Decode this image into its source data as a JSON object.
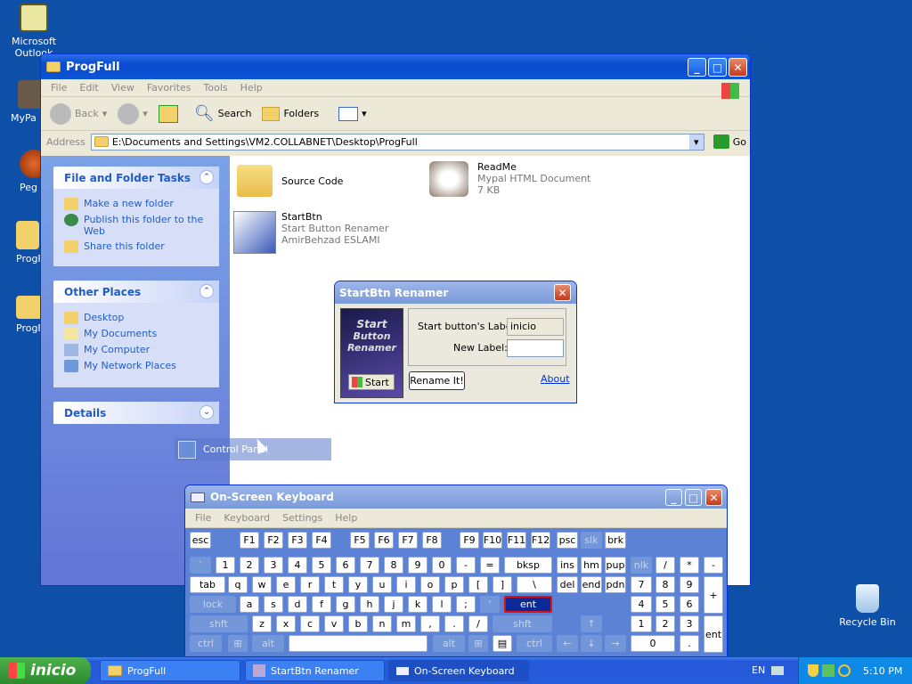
{
  "desktop": {
    "icons": [
      {
        "label": "Microsoft Outlook"
      },
      {
        "label": "MyPa"
      },
      {
        "label": "Peg"
      },
      {
        "label": "ProgF"
      },
      {
        "label": "ProgF"
      }
    ],
    "recycle_bin": "Recycle Bin"
  },
  "explorer": {
    "title": "ProgFull",
    "menu": [
      "File",
      "Edit",
      "View",
      "Favorites",
      "Tools",
      "Help"
    ],
    "toolbar": {
      "back": "Back",
      "search": "Search",
      "folders": "Folders"
    },
    "address_label": "Address",
    "address": "E:\\Documents and Settings\\VM2.COLLABNET\\Desktop\\ProgFull",
    "go": "Go",
    "tasks_header": "File and Folder Tasks",
    "tasks": [
      "Make a new folder",
      "Publish this folder to the Web",
      "Share this folder"
    ],
    "places_header": "Other Places",
    "places": [
      "Desktop",
      "My Documents",
      "My Computer",
      "My Network Places"
    ],
    "details_header": "Details",
    "files": [
      {
        "name": "Source Code",
        "line2": "",
        "line3": ""
      },
      {
        "name": "ReadMe",
        "line2": "Mypal HTML Document",
        "line3": "7 KB"
      },
      {
        "name": "StartBtn",
        "line2": "Start Button Renamer",
        "line3": "AmirBehzad ESLAMI"
      }
    ],
    "drag_item": "Control Panel"
  },
  "dialog": {
    "title": "StartBtn Renamer",
    "logo_lines": [
      "Start",
      "Button",
      "Renamer"
    ],
    "preview_button": "Start",
    "label_current": "Start button's Label:",
    "current_value": "inicio",
    "label_new": "New Label:",
    "new_value": "",
    "rename_button": "Rename It!",
    "about": "About"
  },
  "osk": {
    "title": "On-Screen Keyboard",
    "menu": [
      "File",
      "Keyboard",
      "Settings",
      "Help"
    ]
  },
  "taskbar": {
    "start": "inicio",
    "tasks": [
      "ProgFull",
      "StartBtn Renamer",
      "On-Screen Keyboard"
    ],
    "lang": "EN",
    "time": "5:10 PM"
  }
}
